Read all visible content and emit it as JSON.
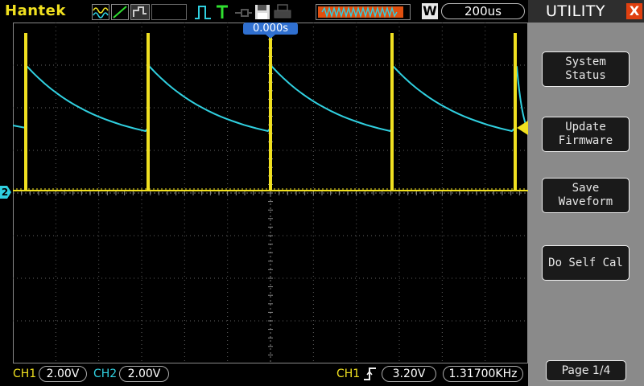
{
  "header": {
    "brand": "Hantek",
    "run_indicator": "W",
    "timebase": "200us",
    "trigger_position": "0.000s"
  },
  "icons": {
    "acquire_mode": "sine-wave-icon",
    "measure": "ramp-icon",
    "autoset": "autoset-icon",
    "trigger_coupling": "pulse-icon",
    "trigger_T": "T",
    "probe": "probe-icon",
    "save": "floppy-disk-icon",
    "print": "printer-icon",
    "memory_bar": "waveform-memory-icon"
  },
  "channels": {
    "ch1": {
      "label": "CH1",
      "scale": "2.00V",
      "color": "#f0e020"
    },
    "ch2": {
      "label": "CH2",
      "scale": "2.00V",
      "color": "#30d0e0",
      "marker": "2"
    }
  },
  "trigger": {
    "source": "CH1",
    "level": "3.20V",
    "frequency": "1.31700KHz"
  },
  "menu": {
    "title": "UTILITY",
    "close": "X",
    "items": [
      {
        "line1": "System",
        "line2": "Status"
      },
      {
        "line1": "Update",
        "line2": "Firmware"
      },
      {
        "line1": "Save",
        "line2": "Waveform"
      },
      {
        "line1": "Do Self Cal",
        "line2": ""
      }
    ],
    "page": "Page 1/4"
  },
  "colors": {
    "ch1": "#f0e020",
    "ch2": "#30d0e0",
    "grid": "#606060",
    "panel": "#8a8a8a",
    "trigger_marker": "#f0e020"
  }
}
